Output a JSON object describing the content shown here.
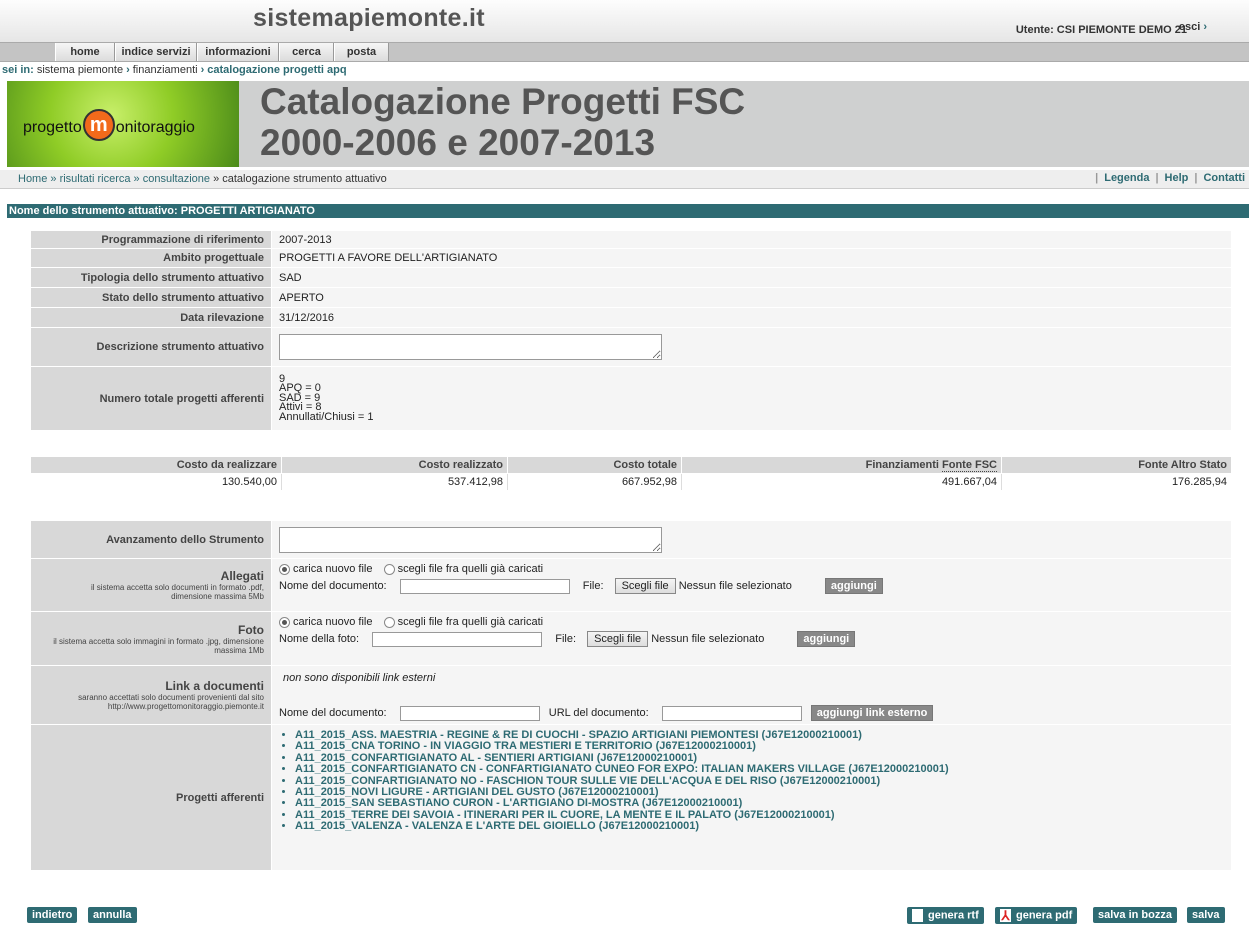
{
  "site_title": "sistemapiemonte.it",
  "user": "Utente: CSI PIEMONTE DEMO 21",
  "logout_label": "esci",
  "top_nav": [
    "home",
    "indice servizi",
    "informazioni",
    "cerca",
    "posta"
  ],
  "crumb_top": {
    "label": "sei in:",
    "items": [
      "sistema piemonte",
      "finanziamenti"
    ],
    "current": "catalogazione progetti apq"
  },
  "banner": {
    "logo_left": "progetto",
    "logo_mid": "m",
    "logo_right": "onitoraggio",
    "title_line1": "Catalogazione Progetti FSC",
    "title_line2": "2000-2006 e 2007-2013"
  },
  "crumb_main": {
    "items": [
      "Home",
      "» risultati ricerca",
      "» consultazione"
    ],
    "current": "» catalogazione strumento attuativo",
    "links": [
      "Legenda",
      "Help",
      "Contatti"
    ]
  },
  "section_title": "Nome dello strumento attuativo: PROGETTI ARTIGIANATO",
  "details": [
    {
      "label": "Programmazione di riferimento",
      "value": "2007-2013"
    },
    {
      "label": "Ambito progettuale",
      "value": "PROGETTI A FAVORE DELL'ARTIGIANATO"
    },
    {
      "label": "Tipologia dello strumento attuativo",
      "value": "SAD"
    },
    {
      "label": "Stato dello strumento attuativo",
      "value": "APERTO"
    },
    {
      "label": "Data rilevazione",
      "value": "31/12/2016"
    }
  ],
  "description_label": "Descrizione strumento attuativo",
  "total_projects": {
    "label": "Numero totale progetti afferenti",
    "lines": [
      "9",
      "APQ = 0",
      "SAD = 9",
      "Attivi = 8",
      "Annullati/Chiusi = 1"
    ]
  },
  "costs": {
    "headers": [
      "Costo da realizzare",
      "Costo realizzato",
      "Costo totale",
      "Finanziamenti ",
      "Fonte FSC",
      "Fonte Altro Stato"
    ],
    "values": [
      "130.540,00",
      "537.412,98",
      "667.952,98",
      "491.667,04",
      "176.285,94"
    ]
  },
  "advancement_label": "Avanzamento dello Strumento",
  "attachments": {
    "label": "Allegati",
    "note1": "il sistema accetta solo documenti in formato .pdf,",
    "note2": "dimensione massima 5Mb",
    "radio_new": "carica nuovo file",
    "radio_existing": "scegli file fra quelli già caricati",
    "name_label": "Nome del documento:",
    "file_label": "File:",
    "file_button": "Scegli file",
    "file_status": "Nessun file selezionato",
    "add_button": "aggiungi"
  },
  "photos": {
    "label": "Foto",
    "note1": "il sistema accetta solo immagini in formato .jpg, dimensione",
    "note2": "massima 1Mb",
    "radio_new": "carica nuovo file",
    "radio_existing": "scegli file fra quelli già caricati",
    "name_label": "Nome della foto:",
    "file_label": "File:",
    "file_button": "Scegli file",
    "file_status": "Nessun file selezionato",
    "add_button": "aggiungi"
  },
  "links": {
    "label": "Link a documenti",
    "note1": "saranno accettati solo documenti provenienti dal sito",
    "note2": "http://www.progettomonitoraggio.piemonte.it",
    "empty_msg": "non sono disponibili link esterni",
    "name_label": "Nome del documento:",
    "url_label": "URL del documento:",
    "add_button": "aggiungi link esterno"
  },
  "projects": {
    "label": "Progetti afferenti",
    "items": [
      "A11_2015_ASS. MAESTRIA - REGINE & RE DI CUOCHI - SPAZIO ARTIGIANI PIEMONTESI (J67E12000210001)",
      "A11_2015_CNA TORINO - IN VIAGGIO TRA MESTIERI E TERRITORIO (J67E12000210001)",
      "A11_2015_CONFARTIGIANATO AL - SENTIERI ARTIGIANI (J67E12000210001)",
      "A11_2015_CONFARTIGIANATO CN - CONFARTIGIANATO CUNEO FOR EXPO: ITALIAN MAKERS VILLAGE (J67E12000210001)",
      "A11_2015_CONFARTIGIANATO NO - FASCHION TOUR SULLE VIE DELL'ACQUA E DEL RISO (J67E12000210001)",
      "A11_2015_NOVI LIGURE - ARTIGIANI DEL GUSTO (J67E12000210001)",
      "A11_2015_SAN SEBASTIANO CURON - L'ARTIGIANO DI-MOSTRA (J67E12000210001)",
      "A11_2015_TERRE DEI SAVOIA - ITINERARI PER IL CUORE, LA MENTE E IL PALATO (J67E12000210001)",
      "A11_2015_VALENZA - VALENZA E L'ARTE DEL GIOIELLO (J67E12000210001)"
    ]
  },
  "buttons": {
    "back": "indietro",
    "cancel": "annulla",
    "rtf": "genera rtf",
    "pdf": "genera pdf",
    "draft": "salva in bozza",
    "save": "salva"
  },
  "colors": {
    "accent": "#2e6b73",
    "label_bg": "#d8d8d8",
    "banner_bg": "#cfd0d0"
  }
}
